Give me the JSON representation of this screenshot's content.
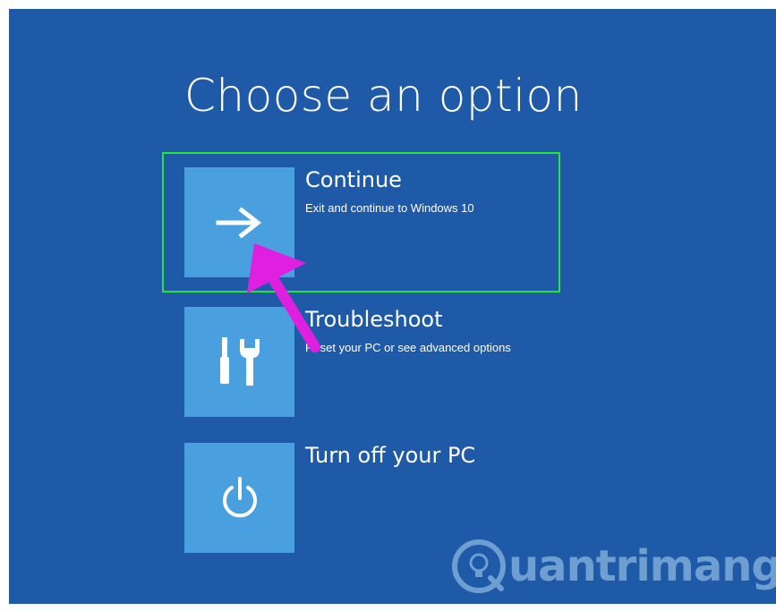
{
  "page": {
    "title": "Choose an option"
  },
  "options": [
    {
      "label": "Continue",
      "description": "Exit and continue to Windows 10",
      "icon": "arrow-right-icon"
    },
    {
      "label": "Troubleshoot",
      "description": "Reset your PC or see advanced options",
      "icon": "tools-icon"
    },
    {
      "label": "Turn off your PC",
      "description": "",
      "icon": "power-icon"
    }
  ],
  "annotation": {
    "highlight_color": "#25e43a",
    "arrow_color": "#e020e0"
  },
  "watermark": {
    "text": "uantrimang",
    "logo": "quantrimang-logo"
  },
  "colors": {
    "background": "#1f5aa8",
    "tile": "#4a9fde",
    "text": "#ffffff"
  }
}
